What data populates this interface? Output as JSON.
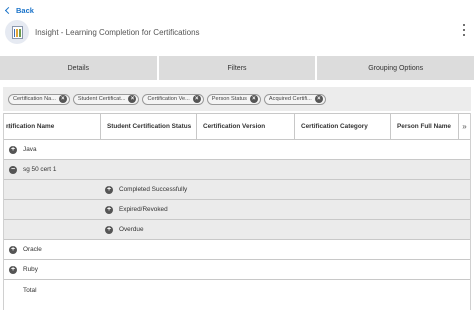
{
  "nav": {
    "back_label": "Back"
  },
  "header": {
    "title": "Insight - Learning Completion for Certifications"
  },
  "tabs": [
    {
      "label": "Details"
    },
    {
      "label": "Filters"
    },
    {
      "label": "Grouping Options"
    }
  ],
  "chips": [
    {
      "label": "Certification Na..."
    },
    {
      "label": "Student Certificat..."
    },
    {
      "label": "Certification Ve..."
    },
    {
      "label": "Person Status"
    },
    {
      "label": "Acquired Certifi..."
    }
  ],
  "table": {
    "scroll_left": "«",
    "scroll_right": "»",
    "columns": [
      "rtification Name",
      "Student Certification Status",
      "Certification Version",
      "Certification Category",
      "Person Full Name"
    ],
    "rows": [
      {
        "label": "Java",
        "toggle": "+"
      },
      {
        "label": "sg 50 cert 1",
        "toggle": "−"
      },
      {
        "label": "Completed Successfully",
        "toggle": "+"
      },
      {
        "label": "Expired/Revoked",
        "toggle": "+"
      },
      {
        "label": "Overdue",
        "toggle": "+"
      },
      {
        "label": "Oracle",
        "toggle": "+"
      },
      {
        "label": "Ruby",
        "toggle": "+"
      },
      {
        "label": "Total"
      }
    ]
  },
  "colors": {
    "accent": "#1a73c9",
    "tab_bg": "#dcdcdc",
    "group_row_bg": "#ebebeb"
  }
}
